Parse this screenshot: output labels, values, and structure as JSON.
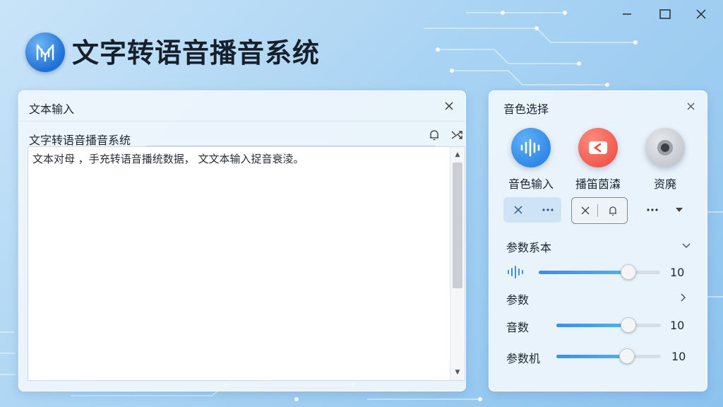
{
  "app": {
    "title": "文字转语音播音系统",
    "logo_icon": "waveform-logo-icon"
  },
  "window_controls": [
    "minimize",
    "maximize",
    "close"
  ],
  "text_panel": {
    "title": "文本输入",
    "subtitle": "文字转语音播音系统",
    "content": "文本对⺟ ，手充转语音播统数据， 文文本输入捉音衰淩。"
  },
  "voice_panel": {
    "title": "音色选择",
    "voices": [
      {
        "label": "音色输入",
        "icon": "soundwave-icon",
        "color": "#2f86e8"
      },
      {
        "label": "播笛茵潹",
        "icon": "video-icon",
        "color": "#f0655a"
      },
      {
        "label": "资廃",
        "icon": "record-icon",
        "color": "#9aa1a8"
      }
    ],
    "params_section": {
      "label": "参数系本",
      "volume_value": "10",
      "volume_level": 0.73
    },
    "params_sub": {
      "label": "参数",
      "sliders": [
        {
          "label": "音数",
          "value": "10",
          "level": 0.68
        },
        {
          "label": "参数机",
          "value": "10",
          "level": 0.67
        }
      ]
    }
  },
  "colors": {
    "accent": "#3b8fe6",
    "panel_bg": "#f0f6fc"
  }
}
